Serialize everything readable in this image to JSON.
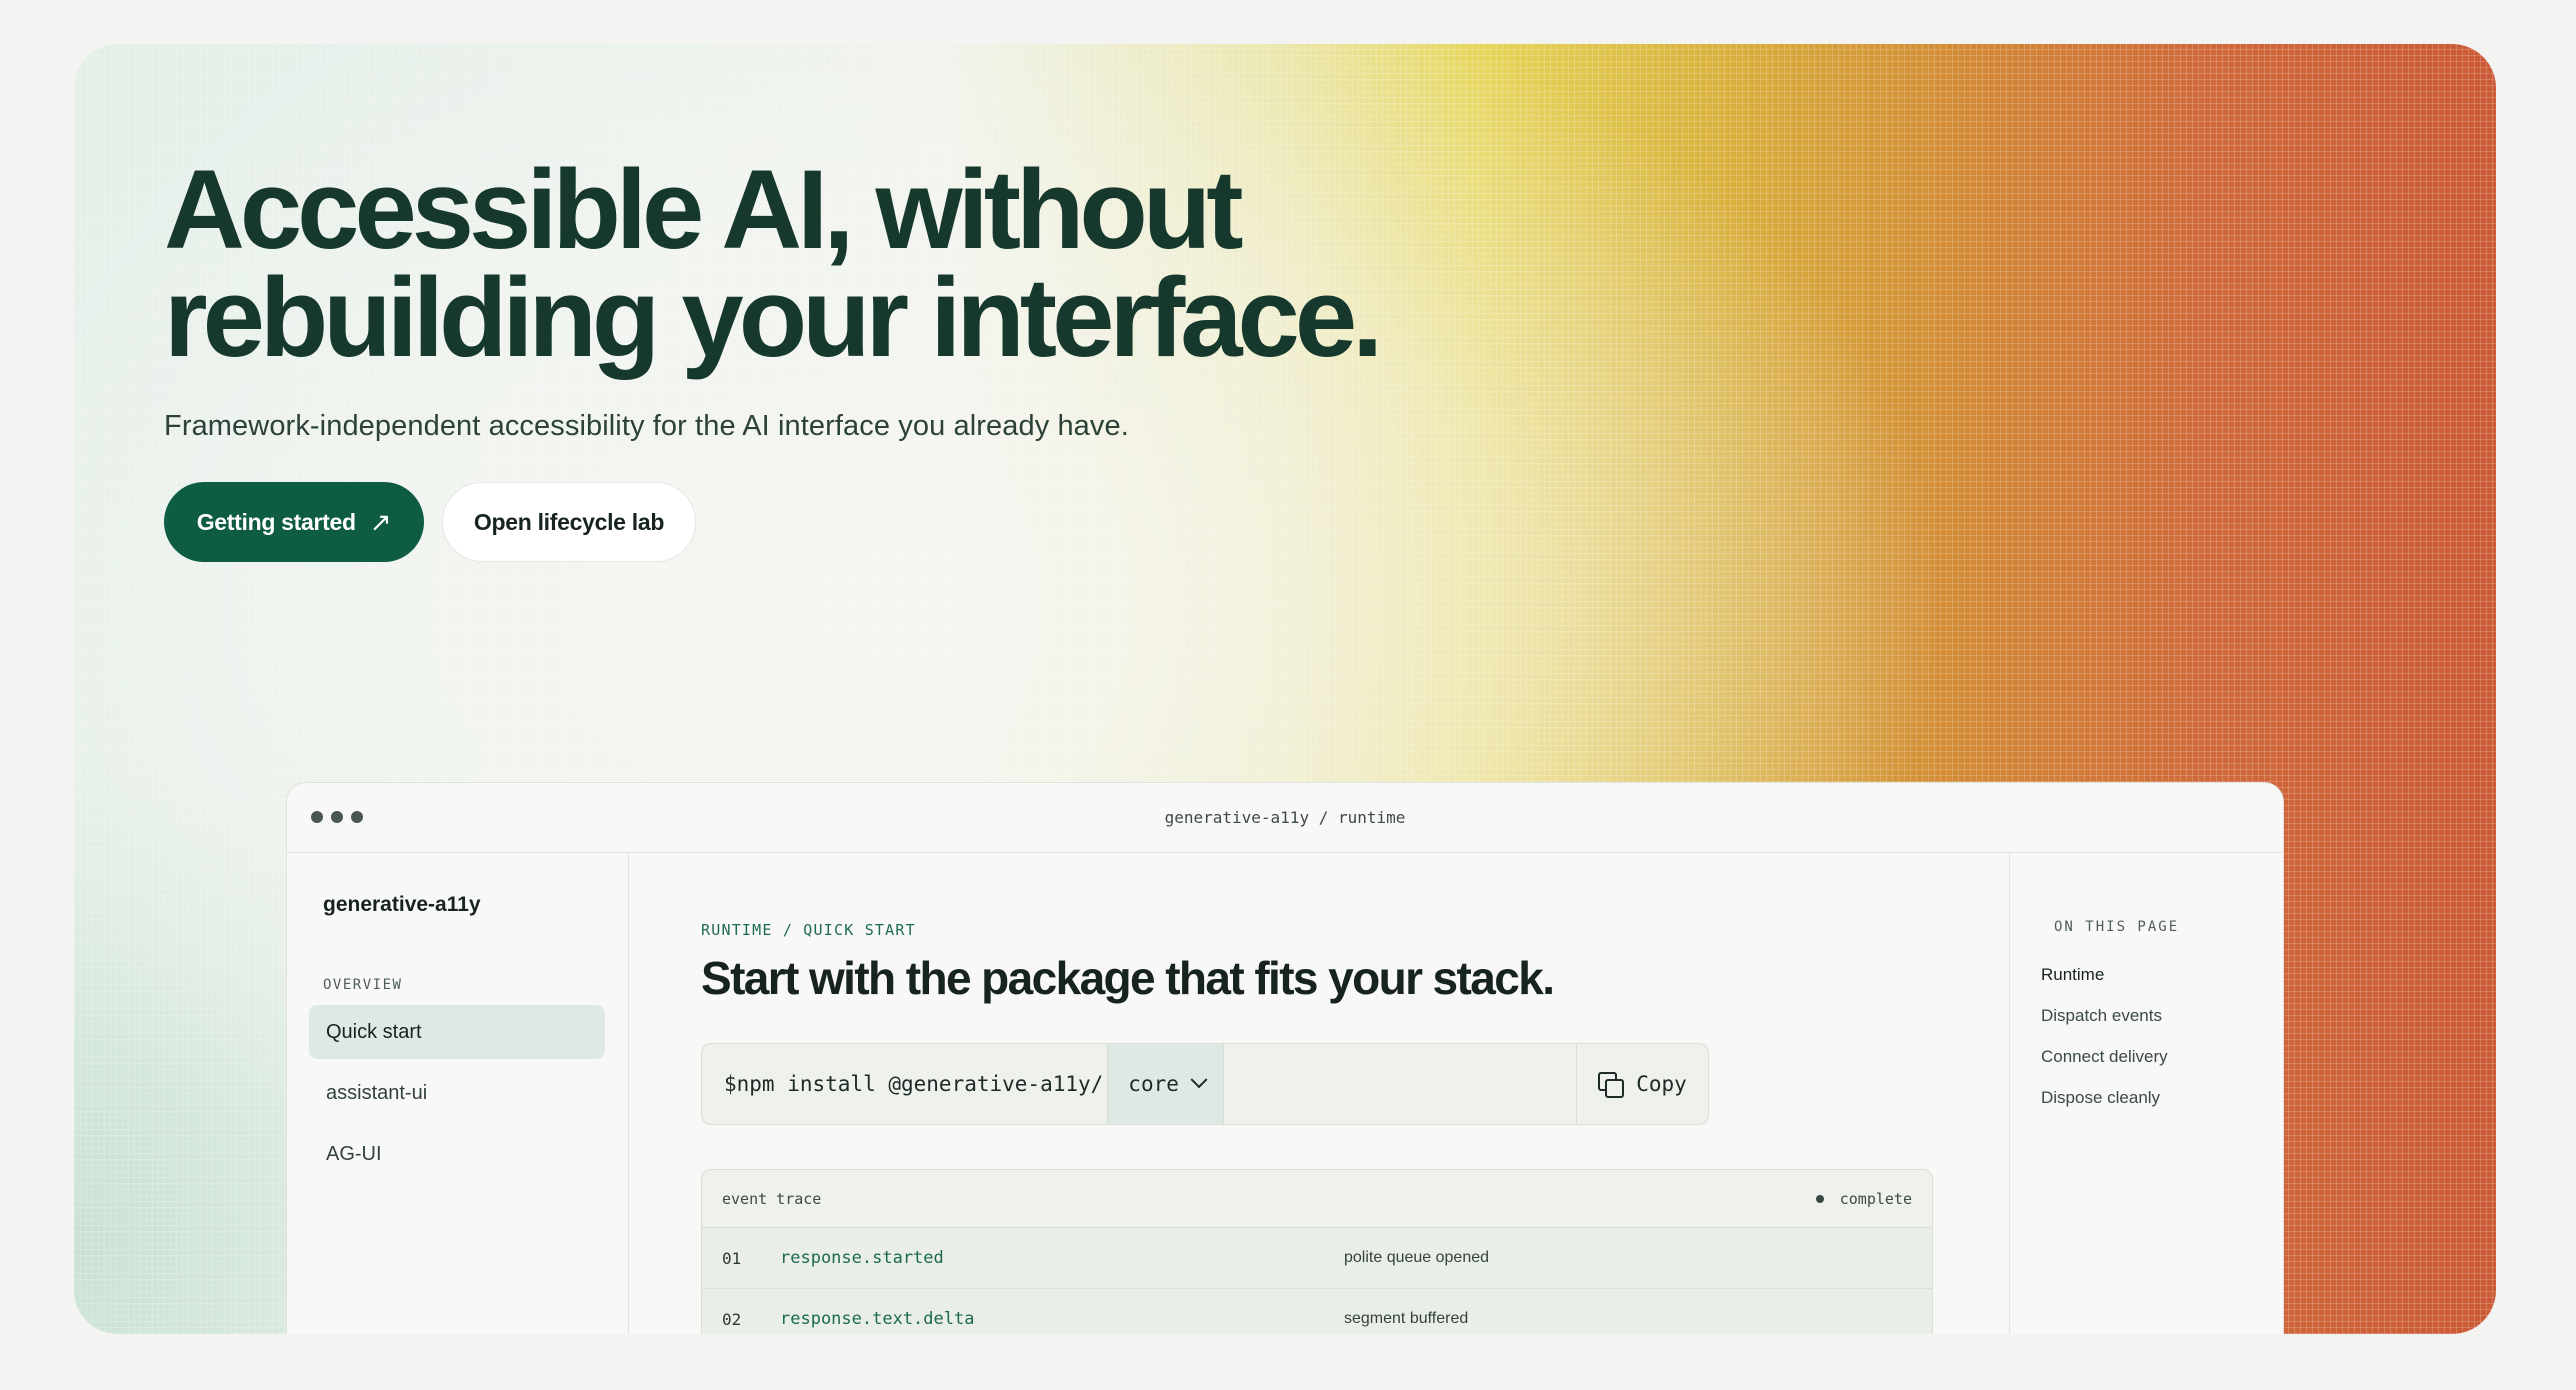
{
  "hero": {
    "headline_line1": "Accessible AI, without",
    "headline_line2": "rebuilding your interface.",
    "subtitle": "Framework-independent accessibility for the AI interface you already have.",
    "primary_button": "Getting started",
    "primary_button_icon": "arrow-up-right-icon",
    "secondary_button": "Open lifecycle lab"
  },
  "window": {
    "title": "generative-a11y / runtime"
  },
  "sidebar": {
    "brand": "generative-a11y",
    "section_label": "OVERVIEW",
    "items": [
      {
        "label": "Quick start",
        "active": true
      },
      {
        "label": "assistant-ui",
        "active": false
      },
      {
        "label": "AG-UI",
        "active": false
      }
    ]
  },
  "main": {
    "eyebrow": "RUNTIME / QUICK START",
    "title": "Start with the package that fits your stack.",
    "command": {
      "prefix": "$npm install @generative-a11y/",
      "selected_package": "core",
      "copy_label": "Copy"
    },
    "trace": {
      "header_label": "event trace",
      "status": "complete",
      "rows": [
        {
          "num": "01",
          "event": "response.started",
          "description": "polite queue opened"
        },
        {
          "num": "02",
          "event": "response.text.delta",
          "description": "segment buffered"
        }
      ]
    }
  },
  "toc": {
    "label": "ON THIS PAGE",
    "items": [
      {
        "label": "Runtime",
        "current": true
      },
      {
        "label": "Dispatch events",
        "current": false
      },
      {
        "label": "Connect delivery",
        "current": false
      },
      {
        "label": "Dispose cleanly",
        "current": false
      }
    ]
  },
  "colors": {
    "brand_green": "#0f5c45",
    "accent_text": "#1b6a4f",
    "gradient_warm": "#cb5a36"
  }
}
